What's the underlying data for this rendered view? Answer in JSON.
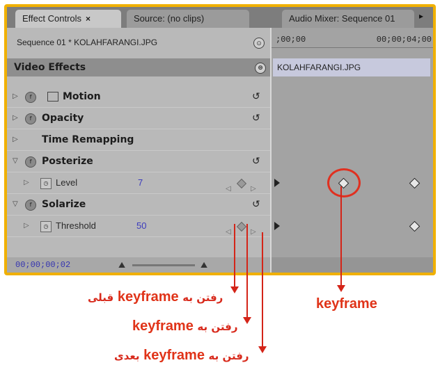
{
  "tabs": [
    {
      "label": "Effect Controls",
      "close": "×"
    },
    {
      "label": "Source: (no clips)"
    },
    {
      "label": "Audio Mixer: Sequence 01"
    }
  ],
  "tab_menu_icon": "double-arrow-icon",
  "sequence_label": "Sequence 01 * KOLAHFARANGI.JPG",
  "video_effects_label": "Video Effects",
  "effects": [
    {
      "name": "Motion"
    },
    {
      "name": "Opacity"
    },
    {
      "name": "Time Remapping"
    },
    {
      "name": "Posterize"
    },
    {
      "name": "Solarize"
    }
  ],
  "params": {
    "level": {
      "name": "Level",
      "value": "7"
    },
    "threshold": {
      "name": "Threshold",
      "value": "50"
    }
  },
  "timecode": "00;00;00;02",
  "timeline": {
    "ruler_start": ";00;00",
    "ruler_end": "00;00;04;00",
    "clip_name": "KOLAHFARANGI.JPG"
  },
  "annotations": {
    "keyframe_word": "keyframe",
    "prev_prefix": "رفتن به",
    "prev_suffix": "قبلی",
    "add_suffix": "رفتن به",
    "next_prefix": "رفتن به",
    "next_suffix": "بعدی",
    "main_label": "keyframe"
  },
  "colors": {
    "frame": "#f0b000",
    "annotation_red": "#d42418",
    "timecode_blue": "#3434b0"
  }
}
